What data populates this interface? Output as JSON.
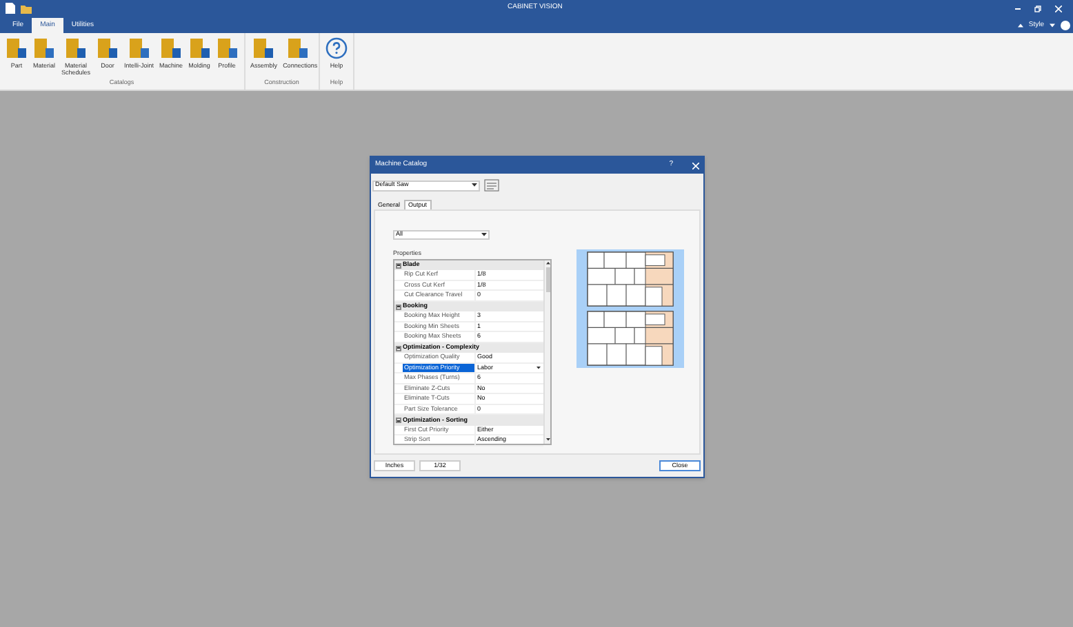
{
  "window": {
    "title": "CABINET VISION"
  },
  "menu_tabs": [
    {
      "label": "File",
      "selected": false
    },
    {
      "label": "Main",
      "selected": true
    },
    {
      "label": "Utilities",
      "selected": false
    }
  ],
  "style_label": "Style",
  "ribbon_groups": [
    {
      "label": "Catalogs",
      "buttons": [
        {
          "label": "Part"
        },
        {
          "label": "Material"
        },
        {
          "label": "Material Schedules"
        },
        {
          "label": "Door"
        },
        {
          "label": "Intelli-Joint"
        },
        {
          "label": "Machine"
        },
        {
          "label": "Molding"
        },
        {
          "label": "Profile"
        }
      ]
    },
    {
      "label": "Construction",
      "buttons": [
        {
          "label": "Assembly"
        },
        {
          "label": "Connections"
        }
      ]
    },
    {
      "label": "Help",
      "buttons": [
        {
          "label": "Help",
          "kind": "help"
        }
      ]
    }
  ],
  "dialog": {
    "title": "Machine Catalog",
    "help": "?",
    "machine": "Default Saw",
    "tabs": [
      {
        "label": "General",
        "selected": false
      },
      {
        "label": "Output",
        "selected": true
      }
    ],
    "filter": "All",
    "properties_label": "Properties",
    "categories": [
      {
        "name": "Blade",
        "expanded": true,
        "rows": [
          {
            "name": "Rip Cut Kerf",
            "value": "1/8",
            "selected": false
          },
          {
            "name": "Cross Cut Kerf",
            "value": "1/8",
            "selected": false
          },
          {
            "name": "Cut Clearance Travel",
            "value": "0",
            "selected": false
          }
        ]
      },
      {
        "name": "Booking",
        "expanded": true,
        "rows": [
          {
            "name": "Booking Max Height",
            "value": "3",
            "selected": false
          },
          {
            "name": "Booking Min Sheets",
            "value": "1",
            "selected": false
          },
          {
            "name": "Booking Max Sheets",
            "value": "6",
            "selected": false
          }
        ]
      },
      {
        "name": "Optimization - Complexity",
        "expanded": true,
        "rows": [
          {
            "name": "Optimization Quality",
            "value": "Good",
            "selected": false
          },
          {
            "name": "Optimization Priority",
            "value": "Labor",
            "selected": true
          },
          {
            "name": "Max Phases (Turns)",
            "value": "6",
            "selected": false
          },
          {
            "name": "Eliminate Z-Cuts",
            "value": "No",
            "selected": false
          },
          {
            "name": "Eliminate T-Cuts",
            "value": "No",
            "selected": false
          },
          {
            "name": "Part Size Tolerance",
            "value": "0",
            "selected": false
          }
        ]
      },
      {
        "name": "Optimization - Sorting",
        "expanded": true,
        "rows": [
          {
            "name": "First Cut Priority",
            "value": "Either",
            "selected": false
          },
          {
            "name": "Strip Sort",
            "value": "Ascending",
            "selected": false
          }
        ]
      }
    ],
    "footer_left": [
      "Inches",
      "1/32"
    ],
    "close": "Close"
  }
}
